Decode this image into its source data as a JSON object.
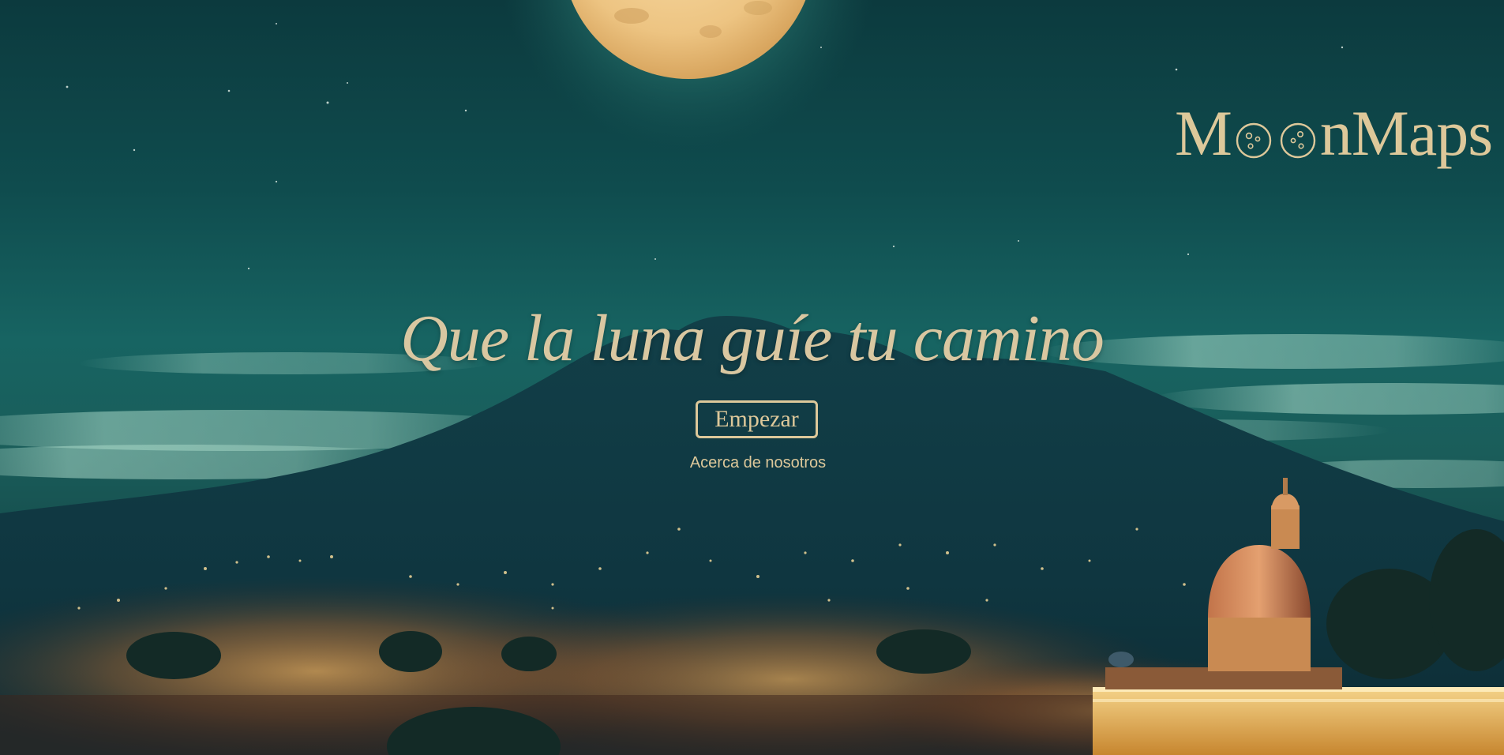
{
  "brand": {
    "logo_text_start": "M",
    "logo_text_end": "nMaps"
  },
  "hero": {
    "title": "Que la luna guíe tu camino",
    "cta_label": "Empezar",
    "about_link": "Acerca de nosotros"
  },
  "colors": {
    "accent": "#ddc89a",
    "sky": "#0f4a4c",
    "moon": "#f0c987",
    "city_glow": "#f08a3a"
  },
  "icons": {
    "logo_moon": "moon-o-icon"
  }
}
